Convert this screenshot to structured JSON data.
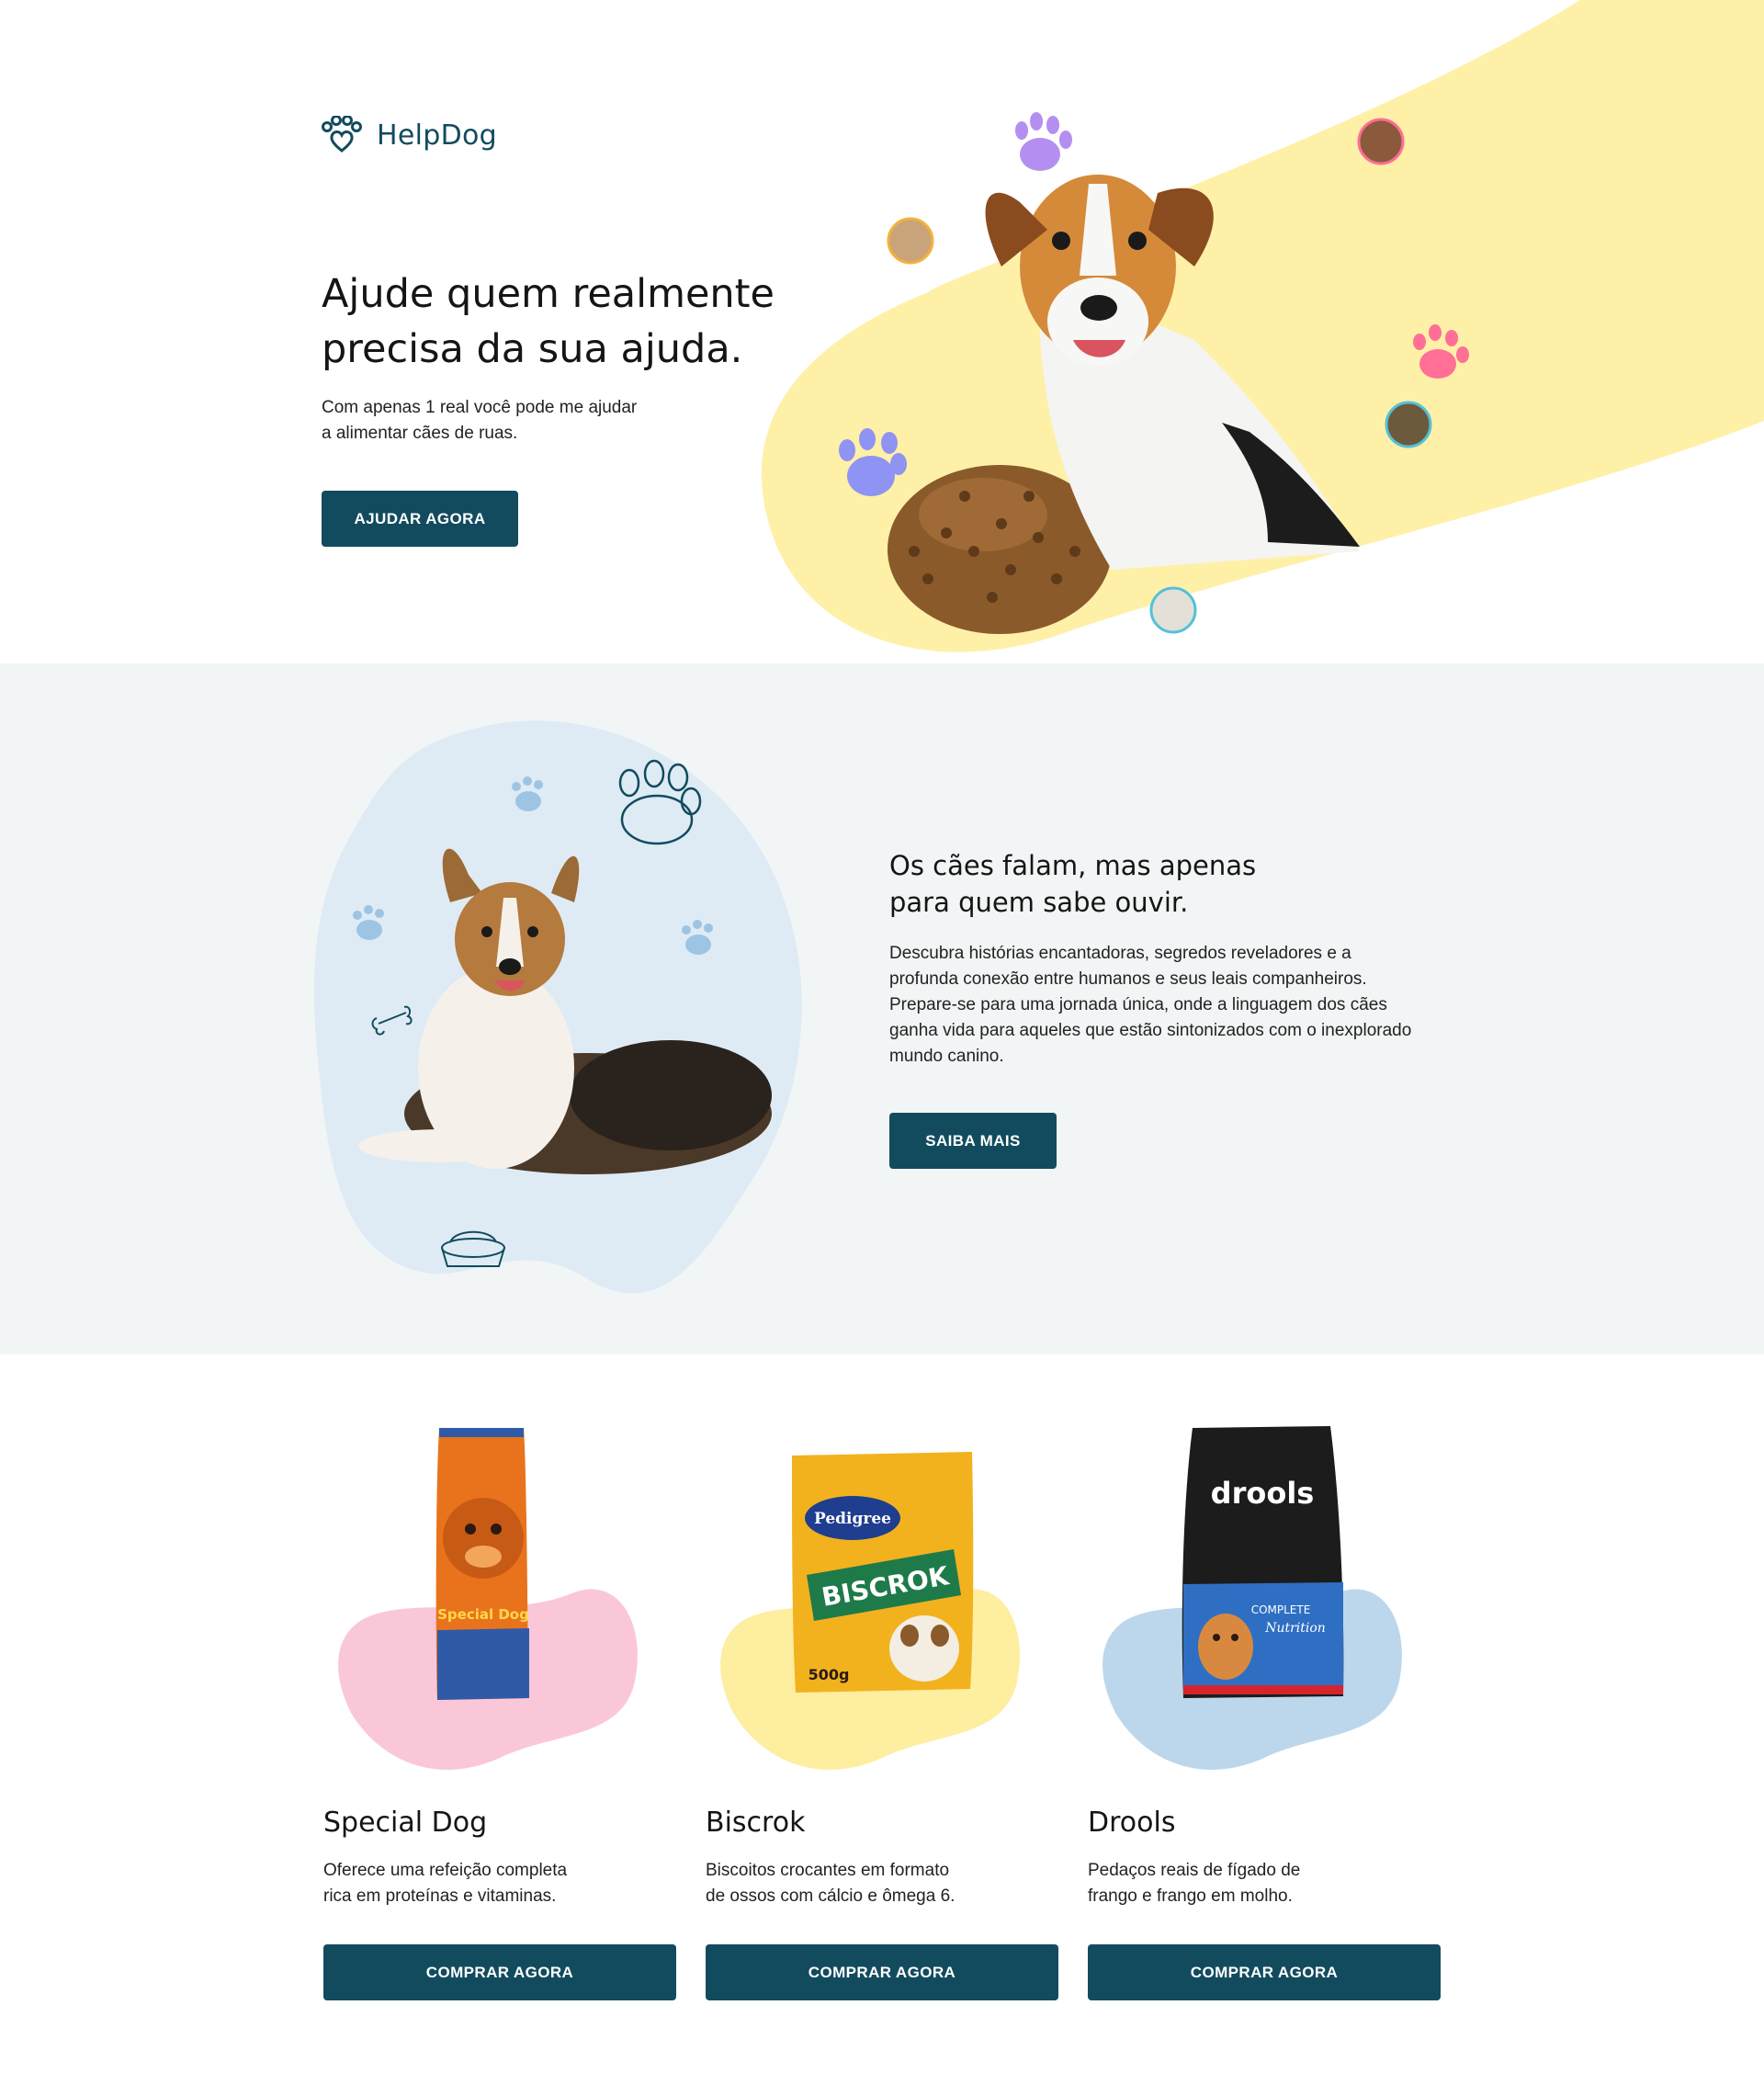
{
  "brand": {
    "name": "HelpDog",
    "logo_icon": "paw-heart-icon",
    "primary_color": "#124b5e"
  },
  "hero": {
    "title_lines": [
      "Ajude quem realmente",
      "precisa da sua ajuda."
    ],
    "subtitle_lines": [
      "Com apenas 1 real você pode me ajudar",
      "a alimentar cães de ruas."
    ],
    "cta_label": "AJUDAR AGORA",
    "accent_color": "#fff0a8"
  },
  "about": {
    "title_lines": [
      "Os cães falam, mas apenas",
      "para quem sabe ouvir."
    ],
    "text": "Descubra histórias encantadoras, segredos reveladores e a profunda conexão entre humanos e seus leais companheiros. Prepare-se para uma jornada única, onde a linguagem dos cães ganha vida para aqueles que estão sintonizados com o inexplorado mundo canino.",
    "cta_label": "SAIBA MAIS",
    "blob_color": "#deebf5"
  },
  "products": [
    {
      "name": "Special Dog",
      "desc_lines": [
        "Oferece uma refeição completa",
        "rica em proteínas e vitaminas."
      ],
      "cta_label": "COMPRAR AGORA",
      "blob_color": "#fac7d9",
      "bag_text": "Special Dog"
    },
    {
      "name": "Biscrok",
      "desc_lines": [
        "Biscoitos crocantes em formato",
        "de ossos com cálcio e ômega 6."
      ],
      "cta_label": "COMPRAR AGORA",
      "blob_color": "#fdeea0",
      "bag_text": "Pedigree",
      "bag_text2": "BISCROK",
      "bag_weight": "500g"
    },
    {
      "name": "Drools",
      "desc_lines": [
        "Pedaços reais de fígado de",
        "frango e frango em molho."
      ],
      "cta_label": "COMPRAR AGORA",
      "blob_color": "#bcd7ec",
      "bag_text": "drools",
      "bag_text2": "COMPLETE",
      "bag_text3": "Nutrition"
    }
  ]
}
